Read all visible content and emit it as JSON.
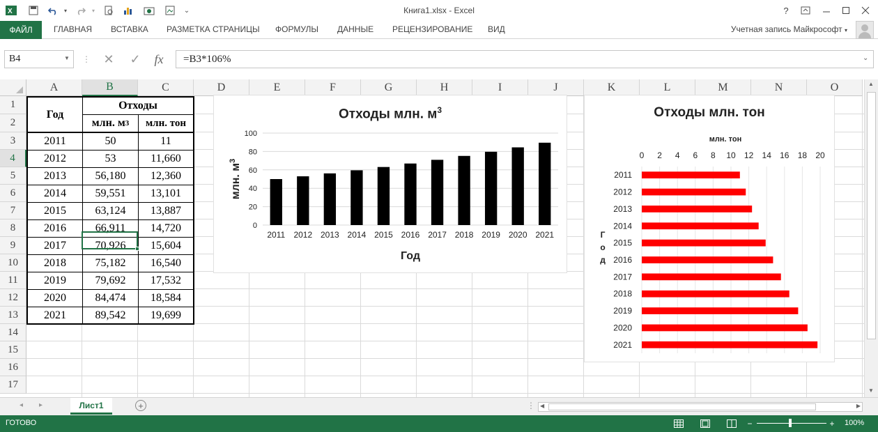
{
  "window": {
    "title": "Книга1.xlsx - Excel",
    "help": "?",
    "qat_more": "⌄"
  },
  "ribbon": {
    "file": "ФАЙЛ",
    "tabs": [
      "ГЛАВНАЯ",
      "ВСТАВКА",
      "РАЗМЕТКА СТРАНИЦЫ",
      "ФОРМУЛЫ",
      "ДАННЫЕ",
      "РЕЦЕНЗИРОВАНИЕ",
      "ВИД"
    ],
    "account": "Учетная запись Майкрософт"
  },
  "formula_bar": {
    "name_box": "B4",
    "cancel": "✕",
    "enter": "✓",
    "fx": "fx",
    "formula": "=B3*106%"
  },
  "columns": [
    "A",
    "B",
    "C",
    "D",
    "E",
    "F",
    "G",
    "H",
    "I",
    "J",
    "K",
    "L",
    "M",
    "N",
    "O"
  ],
  "rows": [
    "1",
    "2",
    "3",
    "4",
    "5",
    "6",
    "7",
    "8",
    "9",
    "10",
    "11",
    "12",
    "13",
    "14",
    "15",
    "16",
    "17"
  ],
  "table": {
    "header_year": "Год",
    "header_waste": "Отходы",
    "header_m3": "млн. м",
    "header_m3_sup": "3",
    "header_ton": "млн. тон",
    "data": [
      [
        "2011",
        "50",
        "11"
      ],
      [
        "2012",
        "53",
        "11,660"
      ],
      [
        "2013",
        "56,180",
        "12,360"
      ],
      [
        "2014",
        "59,551",
        "13,101"
      ],
      [
        "2015",
        "63,124",
        "13,887"
      ],
      [
        "2016",
        "66,911",
        "14,720"
      ],
      [
        "2017",
        "70,926",
        "15,604"
      ],
      [
        "2018",
        "75,182",
        "16,540"
      ],
      [
        "2019",
        "79,692",
        "17,532"
      ],
      [
        "2020",
        "84,474",
        "18,584"
      ],
      [
        "2021",
        "89,542",
        "19,699"
      ]
    ]
  },
  "chart_data": [
    {
      "type": "bar",
      "title": "Отходы млн. м",
      "title_sup": "3",
      "xlabel": "Год",
      "ylabel": "млн. м",
      "ylabel_sup": "3",
      "categories": [
        "2011",
        "2012",
        "2013",
        "2014",
        "2015",
        "2016",
        "2017",
        "2018",
        "2019",
        "2020",
        "2021"
      ],
      "values": [
        50,
        53,
        56.18,
        59.551,
        63.124,
        66.911,
        70.926,
        75.182,
        79.692,
        84.474,
        89.542
      ],
      "ylim": [
        0,
        100
      ],
      "yticks": [
        0,
        20,
        40,
        60,
        80,
        100
      ],
      "color": "#000000",
      "grid": true
    },
    {
      "type": "bar",
      "orientation": "horizontal",
      "title": "Отходы млн. тон",
      "xlabel": "млн. тон",
      "ylabel": "Год",
      "categories": [
        "2011",
        "2012",
        "2013",
        "2014",
        "2015",
        "2016",
        "2017",
        "2018",
        "2019",
        "2020",
        "2021"
      ],
      "values": [
        11,
        11.66,
        12.36,
        13.101,
        13.887,
        14.72,
        15.604,
        16.54,
        17.532,
        18.584,
        19.699
      ],
      "xlim": [
        0,
        20
      ],
      "xticks": [
        0,
        2,
        4,
        6,
        8,
        10,
        12,
        14,
        16,
        18,
        20
      ],
      "color": "#ff0000",
      "grid": true,
      "axis_position": "top"
    }
  ],
  "sheets": {
    "active": "Лист1",
    "add": "+"
  },
  "status": {
    "text": "ГОТОВО",
    "zoom": "100%"
  }
}
